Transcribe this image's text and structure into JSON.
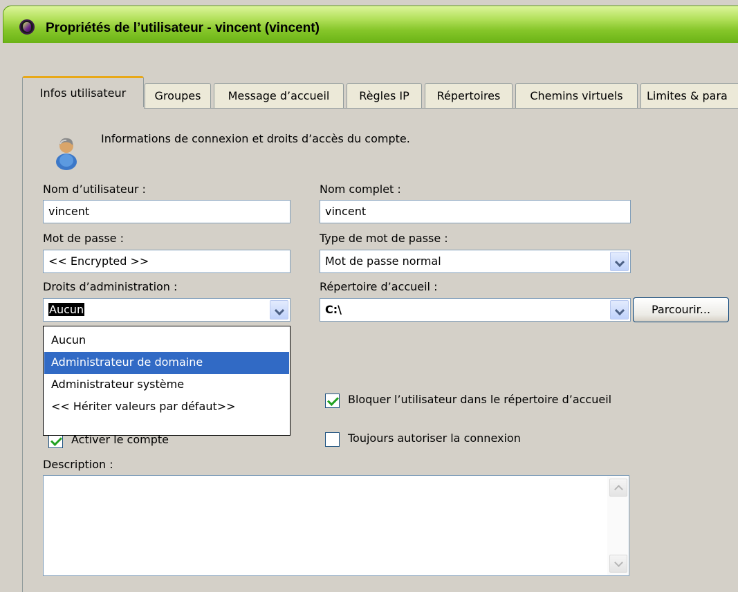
{
  "window": {
    "title": "Propriétés de l’utilisateur - vincent (vincent)",
    "icon": "app-logo-icon"
  },
  "tabs": [
    {
      "label": "Infos utilisateur",
      "active": true
    },
    {
      "label": "Groupes",
      "active": false
    },
    {
      "label": "Message d’accueil",
      "active": false
    },
    {
      "label": "Règles IP",
      "active": false
    },
    {
      "label": "Répertoires",
      "active": false
    },
    {
      "label": "Chemins virtuels",
      "active": false
    },
    {
      "label": "Limites & para",
      "active": false
    }
  ],
  "intro": {
    "icon": "user-icon",
    "text": "Informations de connexion et droits d’accès du compte."
  },
  "form": {
    "username_label": "Nom d’utilisateur :",
    "username_value": "vincent",
    "fullname_label": "Nom complet :",
    "fullname_value": "vincent",
    "password_label": "Mot de passe :",
    "password_value": "<< Encrypted >>",
    "password_type_label": "Type de mot de passe :",
    "password_type_value": "Mot de passe normal",
    "admin_rights_label": "Droits d’administration :",
    "admin_rights_value": "Aucun",
    "home_dir_label": "Répertoire d’accueil :",
    "home_dir_value": "C:\\",
    "browse_button": "Parcourir...",
    "admin_options": [
      {
        "label": "Aucun",
        "highlighted": false
      },
      {
        "label": "Administrateur de domaine",
        "highlighted": true
      },
      {
        "label": "Administrateur système",
        "highlighted": false
      },
      {
        "label": "<< Hériter valeurs par défaut>>",
        "highlighted": false
      }
    ],
    "lock_home_label": "Bloquer l’utilisateur dans le répertoire d’accueil",
    "lock_home_checked": true,
    "activate_label": "Activer le compte",
    "activate_checked": true,
    "always_allow_label": "Toujours autoriser la connexion",
    "always_allow_checked": false,
    "description_label": "Description :",
    "description_value": ""
  },
  "colors": {
    "title_green": "#86c62a",
    "active_tab_accent": "#e8a818",
    "selection_blue": "#316ac5",
    "dialog_bg": "#d4d0c8"
  }
}
